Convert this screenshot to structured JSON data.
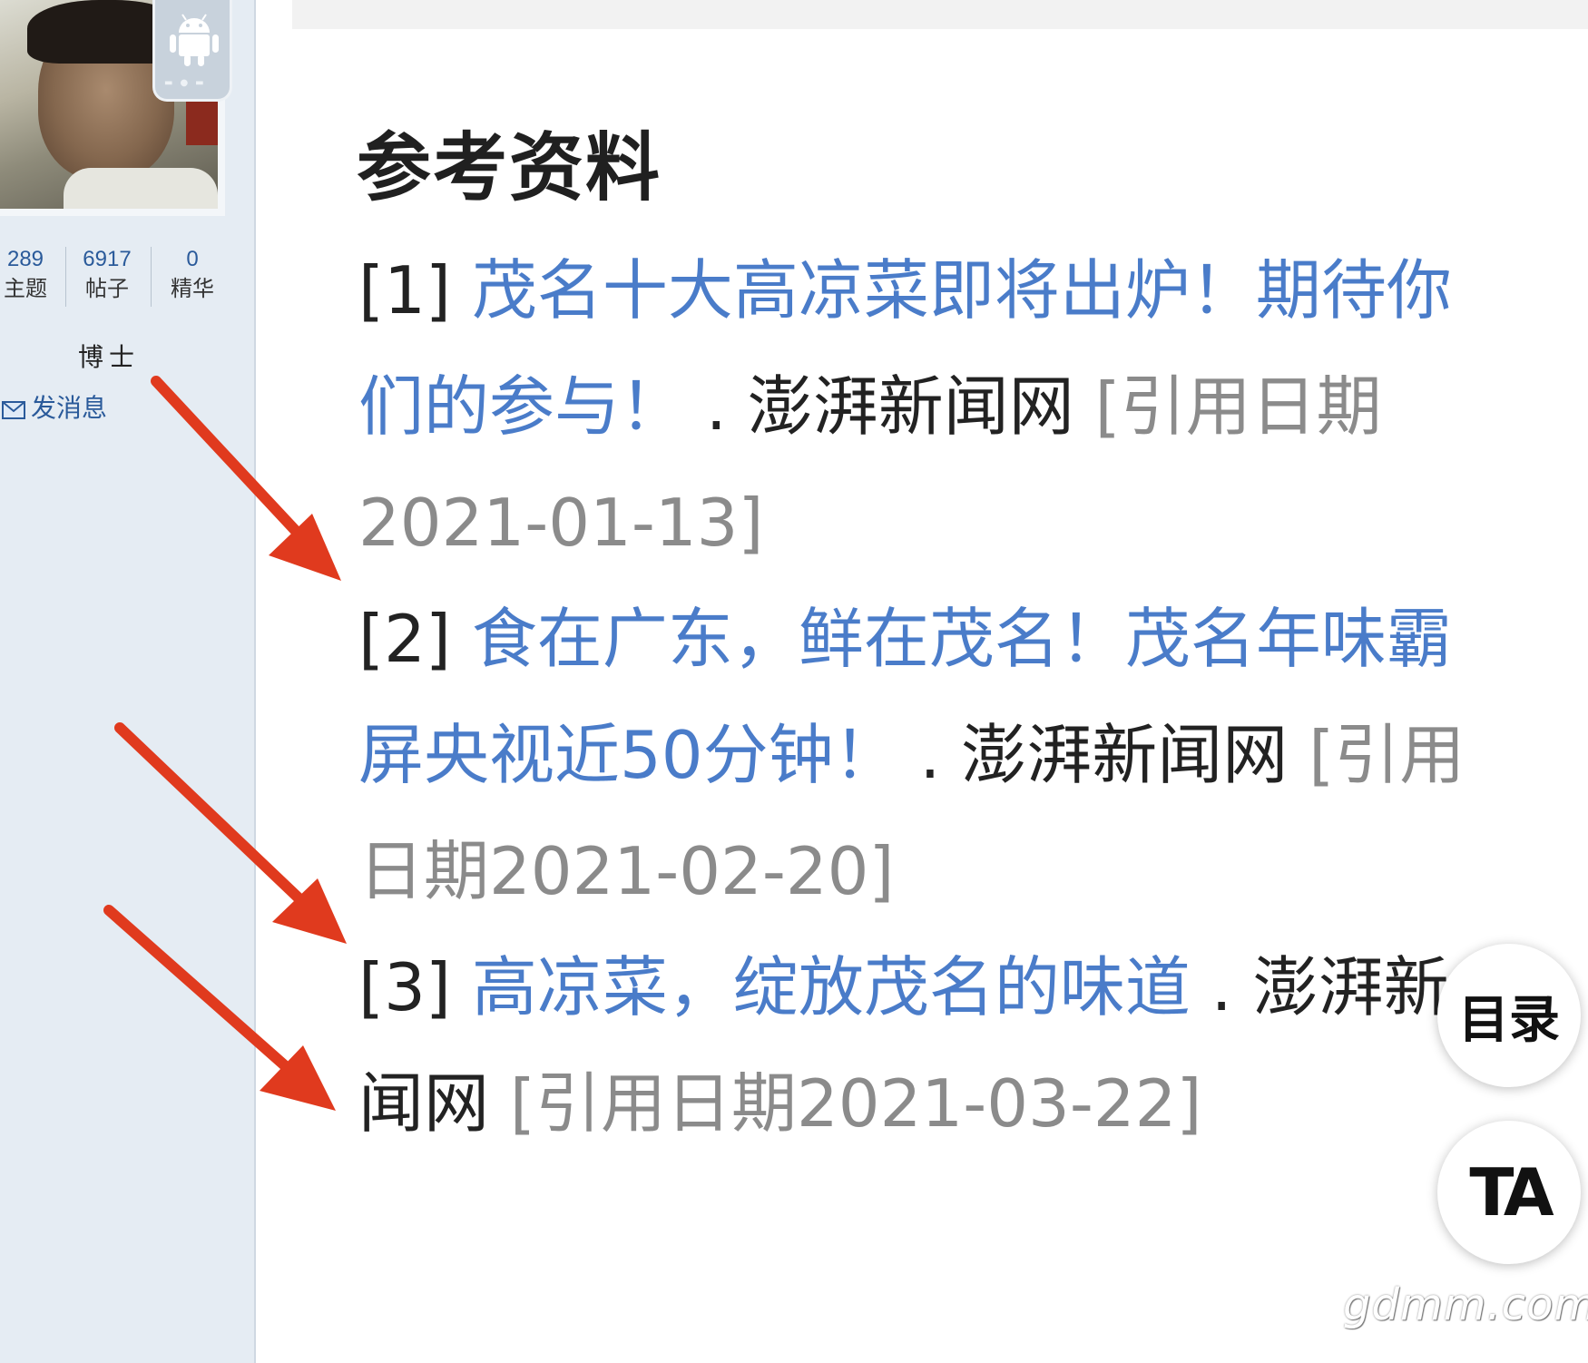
{
  "sidebar": {
    "stats": [
      {
        "value": "289",
        "label": "主题"
      },
      {
        "value": "6917",
        "label": "帖子"
      },
      {
        "value": "0",
        "label": "精华"
      }
    ],
    "rank": "博士",
    "send_message": "发消息",
    "badge_icon": "android-icon"
  },
  "article": {
    "heading": "参考资料",
    "references": [
      {
        "num": "[1]",
        "lines": [
          {
            "link": "茂名十大高凉菜即将出炉！期待你"
          },
          {
            "link": "们的参与！",
            "sep": "  .",
            "source": "澎湃新闻网",
            "cite": "[引用日期"
          },
          {
            "cite": "2021-01-13]"
          }
        ]
      },
      {
        "num": "[2]",
        "lines": [
          {
            "link": "食在广东，鲜在茂名！茂名年味霸"
          },
          {
            "link": "屏央视近50分钟！",
            "sep": "  .",
            "source": "澎湃新闻网",
            "cite": "[引用"
          },
          {
            "cite": "日期2021-02-20]"
          }
        ]
      },
      {
        "num": "[3]",
        "lines": [
          {
            "link": "高凉菜，绽放茂名的味道",
            "sep": ".",
            "source": "澎湃新"
          },
          {
            "source": "闻网",
            "cite": "[引用日期2021-03-22]"
          }
        ]
      }
    ]
  },
  "floating": {
    "toc": "目录",
    "ta": "TA"
  },
  "watermark": "gdmm.com",
  "colors": {
    "link": "#4a7cc9",
    "arrow": "#e03a1e",
    "cite": "#8b8b8b",
    "sidebar_bg": "#e5ecf3"
  }
}
